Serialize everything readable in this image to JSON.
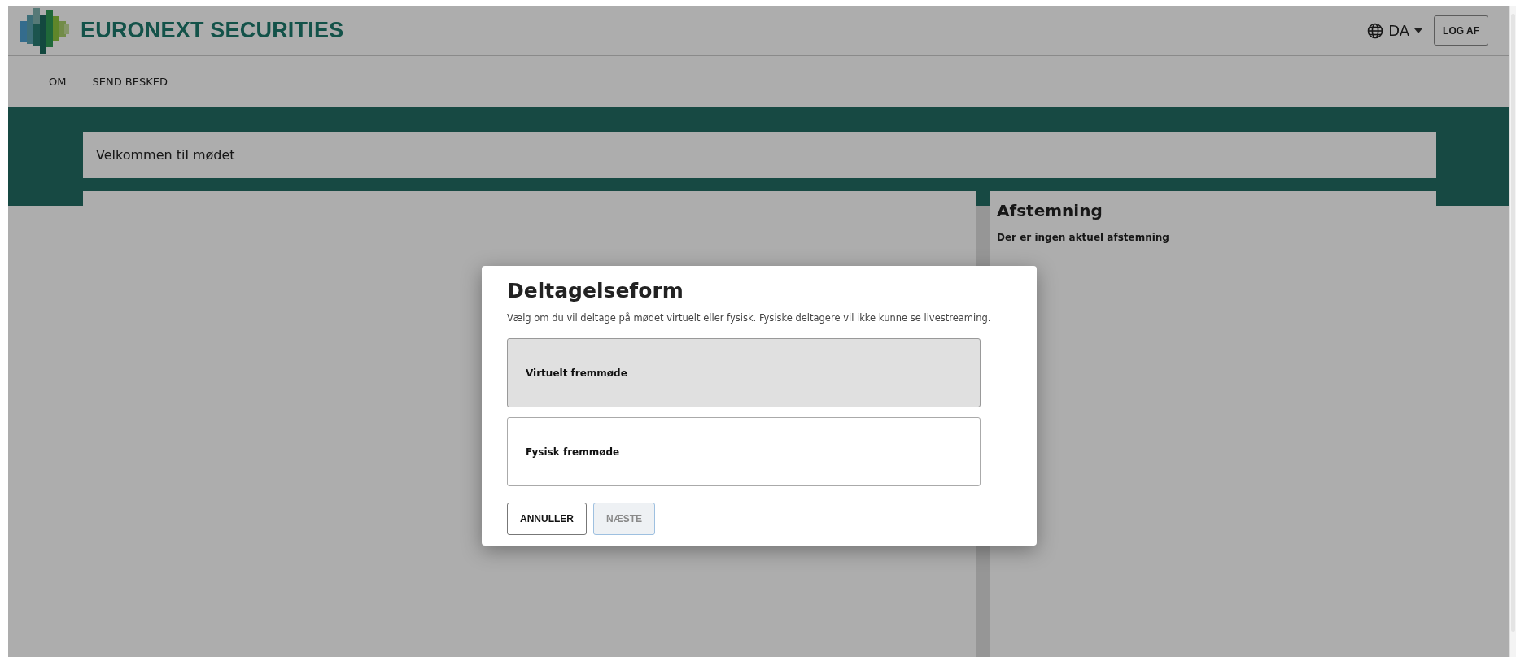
{
  "header": {
    "brand": "EURONEXT SECURITIES",
    "language": "DA",
    "logout": "LOG AF"
  },
  "nav": [
    {
      "label": "OM"
    },
    {
      "label": "SEND BESKED"
    }
  ],
  "welcome": "Velkommen til mødet",
  "voting": {
    "title": "Afstemning",
    "message": "Der er ingen aktuel afstemning"
  },
  "dialog": {
    "title": "Deltagelseform",
    "description": "Vælg om du vil deltage på mødet virtuelt eller fysisk. Fysiske deltagere vil ikke kunne se livestreaming.",
    "options": [
      {
        "label": "Virtuelt fremmøde",
        "selected": true
      },
      {
        "label": "Fysisk fremmøde",
        "selected": false
      }
    ],
    "buttons": [
      {
        "label": "ANNULLER",
        "disabled": false
      },
      {
        "label": "NÆSTE",
        "disabled": true
      }
    ]
  }
}
